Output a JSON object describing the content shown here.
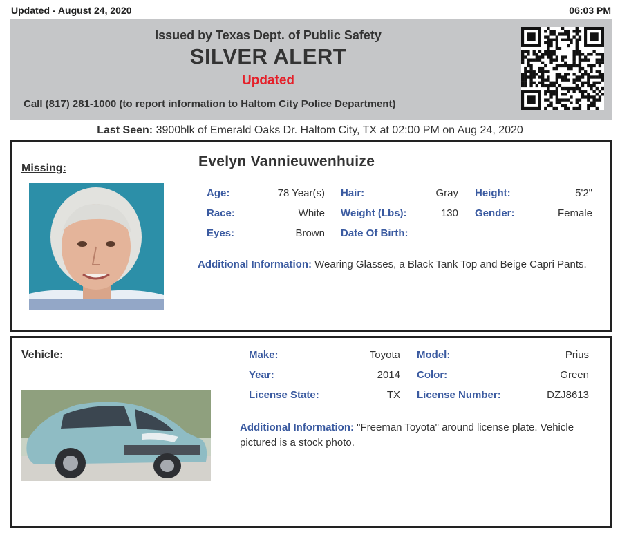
{
  "header": {
    "updated_date": "Updated - August 24, 2020",
    "updated_time": "06:03 PM"
  },
  "banner": {
    "issuer": "Issued by Texas Dept. of Public Safety",
    "title": "SILVER ALERT",
    "status": "Updated",
    "call": "Call (817) 281-1000 (to report information to Haltom City Police Department)"
  },
  "last_seen": {
    "label": "Last Seen:",
    "text": "3900blk of Emerald Oaks Dr. Haltom City, TX at 02:00 PM on Aug 24, 2020"
  },
  "missing": {
    "section_label": "Missing:",
    "name": "Evelyn Vannieuwenhuize",
    "fields": {
      "age_label": "Age:",
      "age": "78 Year(s)",
      "hair_label": "Hair:",
      "hair": "Gray",
      "height_label": "Height:",
      "height": "5'2\"",
      "race_label": "Race:",
      "race": "White",
      "weight_label": "Weight (Lbs):",
      "weight": "130",
      "gender_label": "Gender:",
      "gender": "Female",
      "eyes_label": "Eyes:",
      "eyes": "Brown",
      "dob_label": "Date Of Birth:",
      "dob": ""
    },
    "additional_label": "Additional Information:",
    "additional_text": " Wearing Glasses, a Black Tank Top and Beige Capri Pants."
  },
  "vehicle": {
    "section_label": "Vehicle:",
    "fields": {
      "make_label": "Make:",
      "make": "Toyota",
      "model_label": "Model:",
      "model": "Prius",
      "year_label": "Year:",
      "year": "2014",
      "color_label": "Color:",
      "color": "Green",
      "state_label": "License State:",
      "state": "TX",
      "plate_label": "License Number:",
      "plate": "DZJ8613"
    },
    "additional_label": "Additional Information:",
    "additional_text": " \"Freeman Toyota\" around license plate. Vehicle pictured is a stock photo."
  },
  "colors": {
    "banner_bg": "#c5c6c8",
    "alert_red": "#e5202a",
    "label_blue": "#3a5aa0"
  }
}
